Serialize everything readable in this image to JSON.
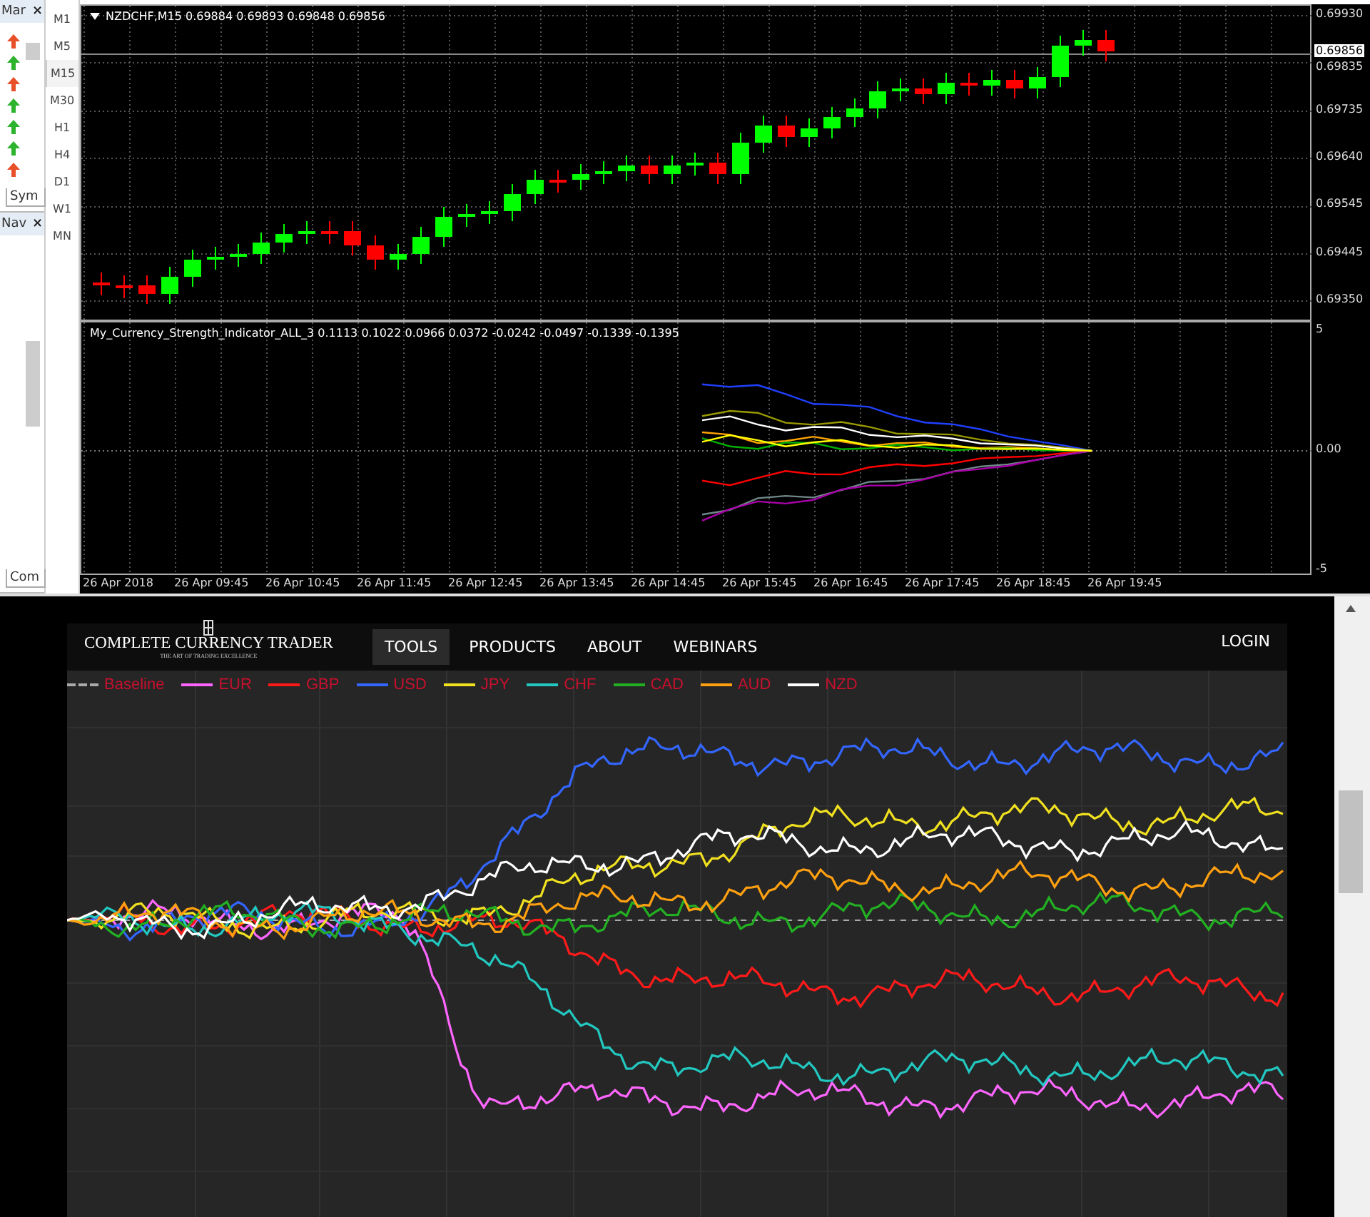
{
  "terminal": {
    "market_watch": {
      "title": "Mar",
      "close": "×",
      "tab": "Sym",
      "rows": [
        {
          "color": "#e8502a"
        },
        {
          "color": "#2db32d"
        },
        {
          "color": "#e8502a"
        },
        {
          "color": "#2db32d"
        },
        {
          "color": "#2db32d"
        },
        {
          "color": "#2db32d"
        },
        {
          "color": "#e8502a"
        }
      ]
    },
    "navigator": {
      "title": "Nav",
      "close": "×",
      "tab": "Com"
    },
    "timeframes": [
      {
        "label": "M1",
        "selected": false
      },
      {
        "label": "M5",
        "selected": false
      },
      {
        "label": "M15",
        "selected": true
      },
      {
        "label": "M30",
        "selected": false
      },
      {
        "label": "H1",
        "selected": false
      },
      {
        "label": "H4",
        "selected": false
      },
      {
        "label": "D1",
        "selected": false
      },
      {
        "label": "W1",
        "selected": false
      },
      {
        "label": "MN",
        "selected": false
      }
    ],
    "chart": {
      "title": "NZDCHF,M15  0.69884 0.69893 0.69848 0.69856",
      "price_labels": [
        "0.69930",
        "0.69835",
        "0.69735",
        "0.69640",
        "0.69545",
        "0.69445",
        "0.69350"
      ],
      "current_price": "0.69856"
    },
    "indicator": {
      "title": "My_Currency_Strength_Indicator_ALL_3 0.1113 0.1022 0.0966 0.0372 -0.0242 -0.0497 -0.1339 -0.1395",
      "scale_labels": [
        "5",
        "0.00",
        "-5"
      ]
    },
    "time_labels": [
      "26 Apr 2018",
      "26 Apr 09:45",
      "26 Apr 10:45",
      "26 Apr 11:45",
      "26 Apr 12:45",
      "26 Apr 13:45",
      "26 Apr 14:45",
      "26 Apr 15:45",
      "26 Apr 16:45",
      "26 Apr 17:45",
      "26 Apr 18:45",
      "26 Apr 19:45"
    ]
  },
  "site": {
    "logo": {
      "name": "COMPLETE CURRENCY TRADER",
      "tagline": "THE ART OF TRADING EXCELLENCE"
    },
    "nav": [
      {
        "label": "TOOLS",
        "selected": true
      },
      {
        "label": "PRODUCTS",
        "selected": false
      },
      {
        "label": "ABOUT",
        "selected": false
      },
      {
        "label": "WEBINARS",
        "selected": false
      }
    ],
    "login": "LOGIN",
    "legend": [
      {
        "label": "Baseline",
        "color": "#aaaaaa",
        "kind": "dashed"
      },
      {
        "label": "EUR",
        "color": "#ff66ff",
        "kind": "solid"
      },
      {
        "label": "GBP",
        "color": "#ff1a1a",
        "kind": "solid"
      },
      {
        "label": "USD",
        "color": "#3366ff",
        "kind": "solid"
      },
      {
        "label": "JPY",
        "color": "#f0e020",
        "kind": "solid"
      },
      {
        "label": "CHF",
        "color": "#22c8c0",
        "kind": "solid"
      },
      {
        "label": "CAD",
        "color": "#22b022",
        "kind": "solid"
      },
      {
        "label": "AUD",
        "color": "#ffa010",
        "kind": "solid"
      },
      {
        "label": "NZD",
        "color": "#ffffff",
        "kind": "solid"
      }
    ]
  }
}
